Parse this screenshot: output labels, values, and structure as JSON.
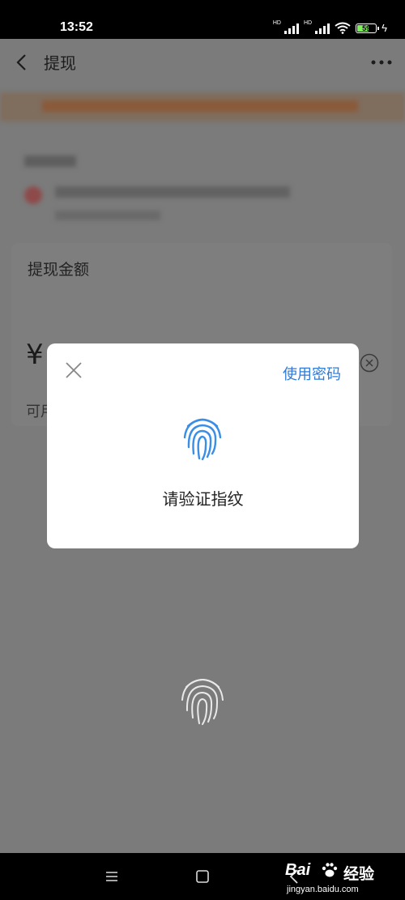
{
  "status": {
    "time": "13:52",
    "hd1": "HD",
    "hd2": "HD",
    "battery": "59"
  },
  "header": {
    "title": "提现"
  },
  "amount": {
    "label": "提现金额",
    "currency": "¥",
    "available": "可用"
  },
  "dialog": {
    "use_password": "使用密码",
    "verify_text": "请验证指纹"
  },
  "watermark": {
    "brand": "Bai",
    "cn": "经验",
    "url": "jingyan.baidu.com"
  },
  "colors": {
    "accent": "#2f7ad6",
    "fingerprint": "#3a8ee6",
    "overlay": "#808080"
  },
  "icons": [
    "back-icon",
    "more-icon",
    "close-icon",
    "fingerprint-icon",
    "clear-icon",
    "menu-icon",
    "home-icon",
    "nav-back-icon"
  ]
}
